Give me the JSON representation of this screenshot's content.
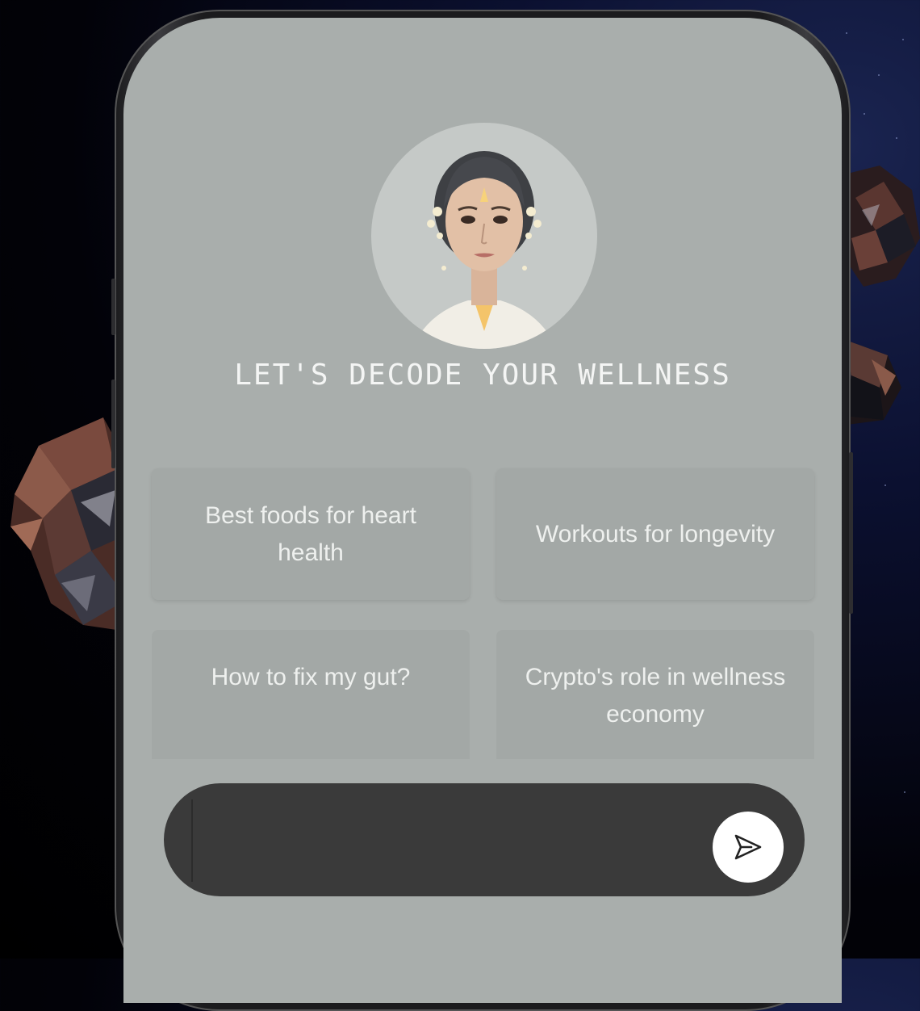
{
  "header": {
    "title": "LET'S DECODE YOUR WELLNESS"
  },
  "avatar": {
    "name": "avatar-image"
  },
  "suggestions": [
    {
      "label": "Best foods for heart health"
    },
    {
      "label": "Workouts for longevity"
    },
    {
      "label": "How to fix my gut?"
    },
    {
      "label": "Crypto's role in wellness economy"
    }
  ],
  "chat_input": {
    "value": "",
    "placeholder": ""
  },
  "icons": {
    "send": "send-icon"
  },
  "colors": {
    "screen_background": "#a9aeac",
    "card_background": "#a3a8a6",
    "input_background": "#3a3a3a",
    "send_button": "#ffffff",
    "page_background": "#020208"
  }
}
